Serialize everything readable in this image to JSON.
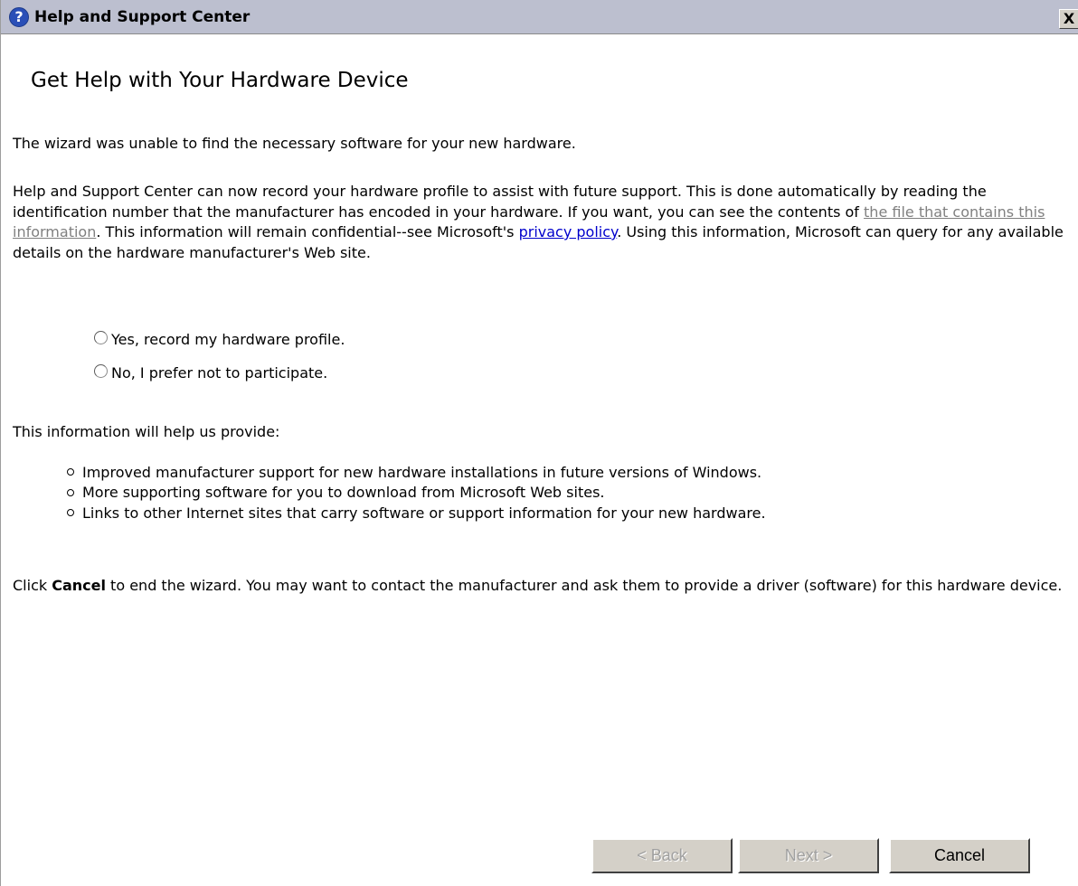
{
  "window": {
    "title": "Help and Support Center",
    "title_icon": "help-icon",
    "close_label": "X"
  },
  "page": {
    "heading": "Get Help with Your Hardware Device",
    "intro": "The wizard was unable to find the necessary software for your new hardware.",
    "profile_text": {
      "part1": "Help and Support Center can now record your hardware profile to assist with future support. This is done automatically by reading the identification number that the manufacturer has encoded in your hardware. If you want, you can see the contents of ",
      "file_link": "the file that contains this information",
      "part2": ". This information will remain confidential--see Microsoft's ",
      "privacy_link": "privacy policy",
      "part3": ". Using this information, Microsoft can query for any available details on the hardware manufacturer's Web site."
    },
    "options": [
      {
        "label": "Yes, record my hardware profile.",
        "selected": false
      },
      {
        "label": "No, I prefer not to participate.",
        "selected": false
      }
    ],
    "benefits_intro": "This information will help us provide:",
    "benefits": [
      "Improved manufacturer support for new hardware installations in future versions of Windows.",
      "More supporting software for you to download from Microsoft Web sites.",
      "Links to other Internet sites that carry software or support information for your new hardware."
    ],
    "cancel_note": {
      "prefix": "Click ",
      "bold": "Cancel",
      "suffix": " to end the wizard. You may want to contact the manufacturer and ask them to provide a driver (software) for this hardware device."
    }
  },
  "buttons": {
    "back": "< Back",
    "next": "Next >",
    "cancel": "Cancel"
  },
  "colors": {
    "titlebar": "#bcbfcf",
    "link_visited": "#808080",
    "link": "#0000cc",
    "button_face": "#d4d0c8"
  }
}
